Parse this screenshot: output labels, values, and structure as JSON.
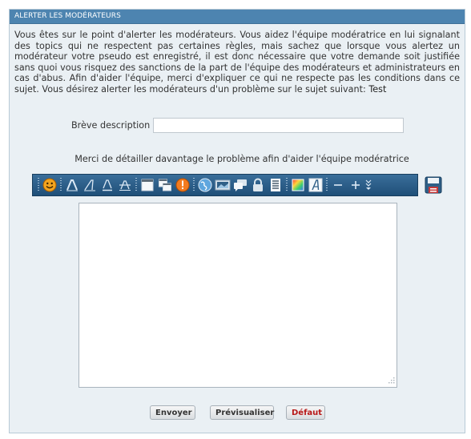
{
  "panel": {
    "title": "ALERTER LES MODÉRATEURS",
    "intro_text": "Vous êtes sur le point d'alerter les modérateurs. Vous aidez l'équipe modératrice en lui signalant des topics qui ne respectent pas certaines règles, mais sachez que lorsque vous alertez un modérateur votre pseudo est enregistré, il est donc nécessaire que votre demande soit justifiée sans quoi vous risquez des sanctions de la part de l'équipe des modérateurs et administrateurs en cas d'abus. Afin d'aider l'équipe, merci d'expliquer ce qui ne respecte pas les conditions dans ce sujet. Vous désirez alerter les modérateurs d'un problème sur le sujet suivant:",
    "topic_name": "Test"
  },
  "form": {
    "short_description_label": "Brève description",
    "short_description_value": "",
    "detail_label": "Merci de détailler davantage le problème afin d'aider l'équipe modératrice",
    "message_value": ""
  },
  "toolbar": {
    "icons": [
      "smiley-icon",
      "bold-icon",
      "italic-icon",
      "underline-icon",
      "strikethrough-icon",
      "align-icon",
      "copy-icon",
      "alert-icon",
      "globe-icon",
      "image-icon",
      "quote-icon",
      "lock-icon",
      "list-icon",
      "color-icon",
      "font-icon",
      "minus-icon",
      "plus-icon",
      "more-icon",
      "save-icon"
    ],
    "accent": "#2b5e89"
  },
  "buttons": {
    "send": "Envoyer",
    "preview": "Prévisualiser",
    "reset": "Défaut"
  },
  "colors": {
    "header_bg": "#4d84b0",
    "panel_bg": "#eaf0f4",
    "reset_text": "#b81818"
  }
}
